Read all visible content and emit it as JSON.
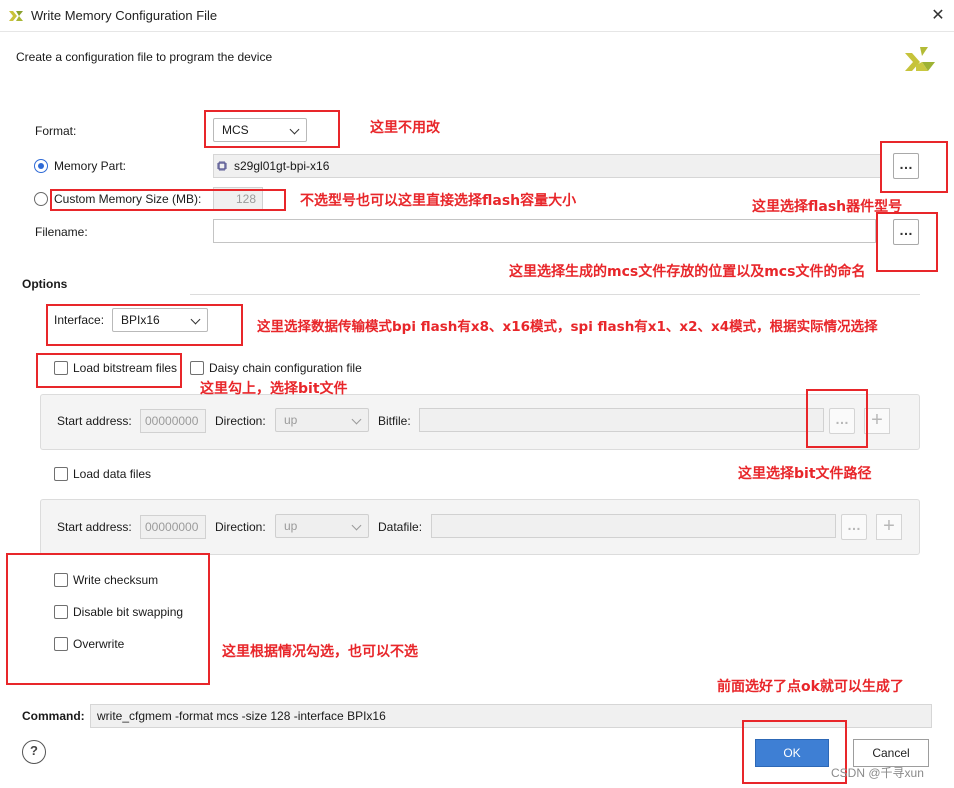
{
  "window": {
    "title": "Write Memory Configuration File",
    "close_glyph": "✕",
    "subtitle": "Create a configuration file to program the device",
    "logo_icon": "xilinx-logo",
    "accent": "#3e7fd4"
  },
  "format": {
    "label": "Format:",
    "value": "MCS"
  },
  "memory_part": {
    "label": "Memory Part:",
    "value": "s29gl01gt-bpi-x16",
    "chip_icon": "chip-icon",
    "browse_label": "…"
  },
  "custom_size": {
    "label": "Custom Memory Size (MB):",
    "value": "128"
  },
  "filename": {
    "label": "Filename:",
    "value": "",
    "browse_label": "…"
  },
  "options": {
    "heading": "Options",
    "interface": {
      "label": "Interface:",
      "value": "BPIx16"
    },
    "load_bitstream": {
      "label": "Load bitstream files",
      "checked": false
    },
    "daisy_chain": {
      "label": "Daisy chain configuration file",
      "checked": false
    },
    "bitstream_row": {
      "start_label": "Start address:",
      "start_value": "00000000",
      "direction_label": "Direction:",
      "direction_value": "up",
      "file_label": "Bitfile:",
      "file_value": "",
      "browse_label": "…",
      "add_label": "+"
    },
    "load_data": {
      "label": "Load data files",
      "checked": false
    },
    "data_row": {
      "start_label": "Start address:",
      "start_value": "00000000",
      "direction_label": "Direction:",
      "direction_value": "up",
      "file_label": "Datafile:",
      "file_value": "",
      "browse_label": "…",
      "add_label": "+"
    },
    "write_checksum": {
      "label": "Write checksum",
      "checked": false
    },
    "disable_bit_swapping": {
      "label": "Disable bit swapping",
      "checked": false
    },
    "overwrite": {
      "label": "Overwrite",
      "checked": false
    }
  },
  "command": {
    "label": "Command:",
    "value": "write_cfgmem  -format mcs -size 128 -interface BPIx16"
  },
  "buttons": {
    "help": "?",
    "ok": "OK",
    "cancel": "Cancel"
  },
  "annotations": {
    "format_note": "这里不用改",
    "size_note": "不选型号也可以这里直接选择flash容量大小",
    "flash_part_note": "这里选择flash器件型号",
    "filename_note": "这里选择生成的mcs文件存放的位置以及mcs文件的命名",
    "interface_note": "这里选择数据传输模式bpi flash有x8、x16模式，spi flash有x1、x2、x4模式，根据实际情况选择",
    "bitstream_note": "这里勾上，选择bit文件",
    "bitfile_note": "这里选择bit文件路径",
    "options_note": "这里根据情况勾选，也可以不选",
    "ok_note": "前面选好了点ok就可以生成了",
    "color": "#e8262a"
  },
  "watermark": "CSDN @千寻xun"
}
